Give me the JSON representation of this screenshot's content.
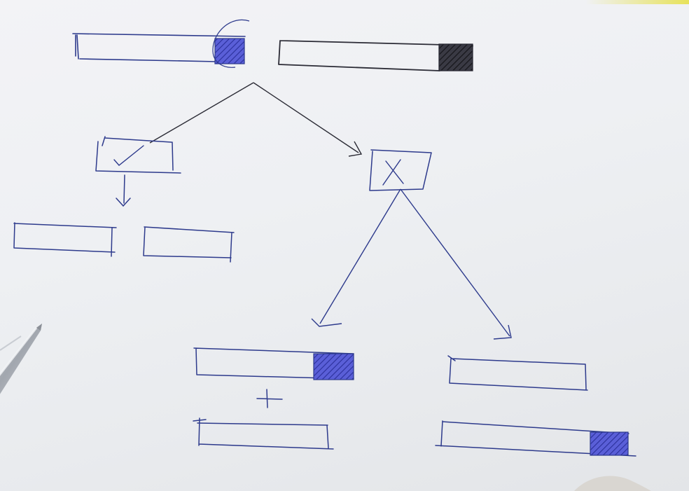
{
  "diagram": {
    "ink_color": "#2d3a8c",
    "ink_dark_color": "#2b2b35",
    "hatch_blue_color": "#4c52d6",
    "hatch_dark_color": "#2c2c33",
    "paper_color": "#eef0f3",
    "nodes": {
      "top_left_bar": {
        "kind": "bar",
        "hatched_end": "blue"
      },
      "top_right_bar": {
        "kind": "bar",
        "hatched_end": "dark"
      },
      "check_box": {
        "kind": "decision",
        "mark": "checkmark"
      },
      "cross_box": {
        "kind": "decision",
        "mark": "cross"
      },
      "check_result_left": {
        "kind": "bar",
        "hatched_end": "none"
      },
      "check_result_right": {
        "kind": "bar",
        "hatched_end": "none"
      },
      "cross_left_result_top": {
        "kind": "bar",
        "hatched_end": "blue"
      },
      "cross_left_result_bottom": {
        "kind": "bar",
        "hatched_end": "none"
      },
      "cross_right_result_top": {
        "kind": "bar",
        "hatched_end": "none"
      },
      "cross_right_result_bottom": {
        "kind": "bar",
        "hatched_end": "blue"
      }
    },
    "plus_sign": "+"
  }
}
